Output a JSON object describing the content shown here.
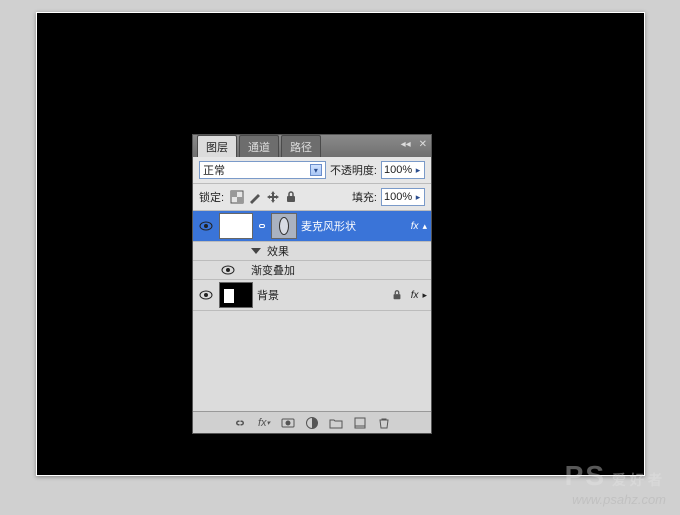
{
  "panel": {
    "tabs": {
      "layers": "图层",
      "channels": "通道",
      "paths": "路径"
    },
    "blend_mode": "正常",
    "opacity_label": "不透明度:",
    "opacity_value": "100%",
    "lock_label": "锁定:",
    "fill_label": "填充:",
    "fill_value": "100%"
  },
  "layers": {
    "shape": {
      "name": "麦克风形状",
      "fx_label": "fx",
      "effects_header": "效果",
      "gradient_overlay": "渐变叠加"
    },
    "background": {
      "name": "背景",
      "fx_label": "fx"
    }
  },
  "titlebar": {
    "collapse": "◂◂",
    "close": "✕"
  },
  "watermark": {
    "logo_big": "PS",
    "logo_small": "爱好者",
    "url": "www.psahz.com"
  }
}
